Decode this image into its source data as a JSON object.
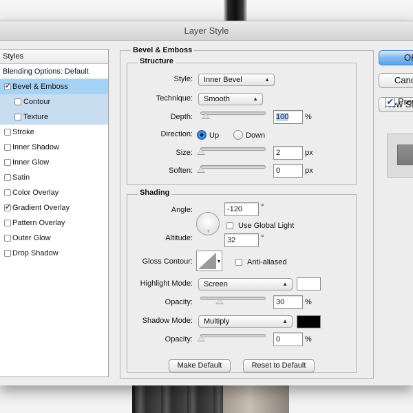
{
  "window": {
    "title": "Layer Style"
  },
  "styles_panel": {
    "header": "Styles",
    "blending_options": "Blending Options: Default",
    "items": [
      {
        "label": "Bevel & Emboss",
        "checked": true,
        "selected": true,
        "sub": false
      },
      {
        "label": "Contour",
        "checked": false,
        "selected": false,
        "sub": true
      },
      {
        "label": "Texture",
        "checked": false,
        "selected": false,
        "sub": true
      },
      {
        "label": "Stroke",
        "checked": false,
        "selected": false,
        "sub": false
      },
      {
        "label": "Inner Shadow",
        "checked": false,
        "selected": false,
        "sub": false
      },
      {
        "label": "Inner Glow",
        "checked": false,
        "selected": false,
        "sub": false
      },
      {
        "label": "Satin",
        "checked": false,
        "selected": false,
        "sub": false
      },
      {
        "label": "Color Overlay",
        "checked": false,
        "selected": false,
        "sub": false
      },
      {
        "label": "Gradient Overlay",
        "checked": true,
        "selected": false,
        "sub": false
      },
      {
        "label": "Pattern Overlay",
        "checked": false,
        "selected": false,
        "sub": false
      },
      {
        "label": "Outer Glow",
        "checked": false,
        "selected": false,
        "sub": false
      },
      {
        "label": "Drop Shadow",
        "checked": false,
        "selected": false,
        "sub": false
      }
    ]
  },
  "bevel_emboss": {
    "title": "Bevel & Emboss",
    "structure": {
      "title": "Structure",
      "style_label": "Style:",
      "style_value": "Inner Bevel",
      "technique_label": "Technique:",
      "technique_value": "Smooth",
      "depth_label": "Depth:",
      "depth_value": "100",
      "depth_unit": "%",
      "depth_slider": 0.1,
      "direction_label": "Direction:",
      "direction_up": "Up",
      "direction_down": "Down",
      "direction_selected": "Up",
      "size_label": "Size:",
      "size_value": "2",
      "size_unit": "px",
      "size_slider": 0.0,
      "soften_label": "Soften:",
      "soften_value": "0",
      "soften_unit": "px",
      "soften_slider": 0.0
    },
    "shading": {
      "title": "Shading",
      "angle_label": "Angle:",
      "angle_value": "-120",
      "angle_unit": "°",
      "use_global_light_label": "Use Global Light",
      "use_global_light": false,
      "altitude_label": "Altitude:",
      "altitude_value": "32",
      "altitude_unit": "°",
      "gloss_contour_label": "Gloss Contour:",
      "anti_aliased_label": "Anti-aliased",
      "anti_aliased": false,
      "highlight_mode_label": "Highlight Mode:",
      "highlight_mode_value": "Screen",
      "highlight_color": "#ffffff",
      "highlight_opacity_label": "Opacity:",
      "highlight_opacity_value": "30",
      "highlight_opacity_unit": "%",
      "highlight_opacity_slider": 0.3,
      "shadow_mode_label": "Shadow Mode:",
      "shadow_mode_value": "Multiply",
      "shadow_color": "#000000",
      "shadow_opacity_label": "Opacity:",
      "shadow_opacity_value": "0",
      "shadow_opacity_unit": "%",
      "shadow_opacity_slider": 0.0
    },
    "make_default": "Make Default",
    "reset_to_default": "Reset to Default"
  },
  "side_buttons": {
    "ok": "OK",
    "cancel": "Cancel",
    "new_style": "New Style...",
    "preview_label": "Preview",
    "preview_checked": true
  }
}
